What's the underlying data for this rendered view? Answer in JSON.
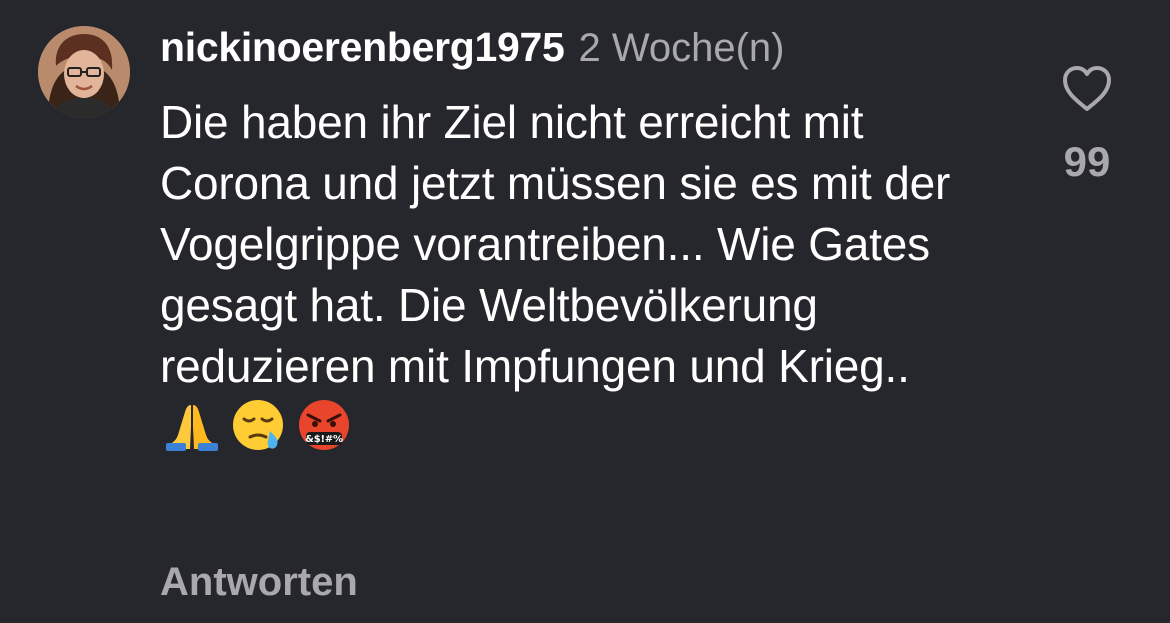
{
  "comment": {
    "username": "nickinoerenberg1975",
    "timestamp": "2 Woche(n)",
    "text": "Die haben ihr Ziel nicht erreicht mit Corona und jetzt müssen sie es mit der Vogelgrippe vorantreiben... Wie Gates gesagt hat. Die Weltbevölkerung reduzieren mit Impfungen und Krieg..",
    "emojis": [
      "folded-hands-emoji",
      "sleepy-face-emoji",
      "face-with-symbols-on-mouth-emoji"
    ],
    "emoji_symbol_text": "&$!#%",
    "reply_label": "Antworten",
    "like_count": "99"
  },
  "icons": {
    "like": "heart-outline-icon",
    "avatar": "profile-photo"
  },
  "colors": {
    "background": "#26272c",
    "primary_text": "#ffffff",
    "secondary_text": "#a8a8ad"
  }
}
